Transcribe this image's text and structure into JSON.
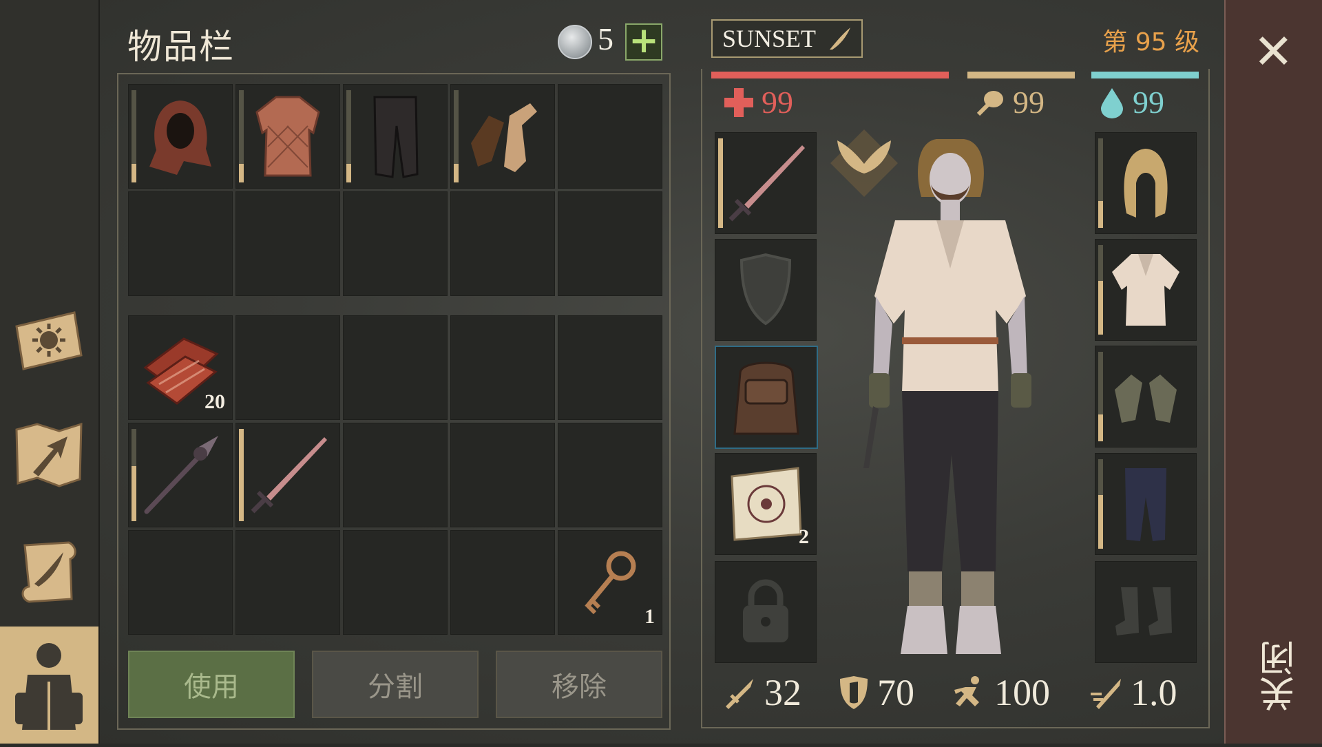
{
  "inventory": {
    "title": "物品栏",
    "currency_count": "5",
    "plus_label": "+"
  },
  "slots_top": [
    {
      "item": "hood",
      "durability": 0.2
    },
    {
      "item": "gambeson",
      "durability": 0.2
    },
    {
      "item": "pants",
      "durability": 0.2
    },
    {
      "item": "gloves",
      "durability": 0.2
    },
    {
      "item": "",
      "durability": null
    },
    {
      "item": "",
      "durability": null
    },
    {
      "item": "",
      "durability": null
    },
    {
      "item": "",
      "durability": null
    },
    {
      "item": "",
      "durability": null
    },
    {
      "item": "",
      "durability": null
    }
  ],
  "slots_bottom": [
    {
      "item": "meat",
      "qty": "20"
    },
    {
      "item": ""
    },
    {
      "item": ""
    },
    {
      "item": ""
    },
    {
      "item": ""
    },
    {
      "item": "spear",
      "durability": 0.6
    },
    {
      "item": "sword",
      "durability": 1.0
    },
    {
      "item": ""
    },
    {
      "item": ""
    },
    {
      "item": ""
    },
    {
      "item": ""
    },
    {
      "item": ""
    },
    {
      "item": ""
    },
    {
      "item": ""
    },
    {
      "item": "key",
      "qty": "1"
    }
  ],
  "actions": {
    "use": "使用",
    "split": "分割",
    "remove": "移除"
  },
  "character": {
    "name": "SUNSET",
    "level": "第 95 级",
    "health": "99",
    "food": "99",
    "water": "99",
    "damage": "32",
    "armor": "70",
    "speed": "100",
    "attack_speed": "1.0",
    "scroll_qty": "2"
  },
  "close": {
    "label": "关闭"
  },
  "colors": {
    "health": "#e15f5a",
    "food": "#d4b785",
    "water": "#7fd0cf",
    "accent": "#e8a14b"
  }
}
